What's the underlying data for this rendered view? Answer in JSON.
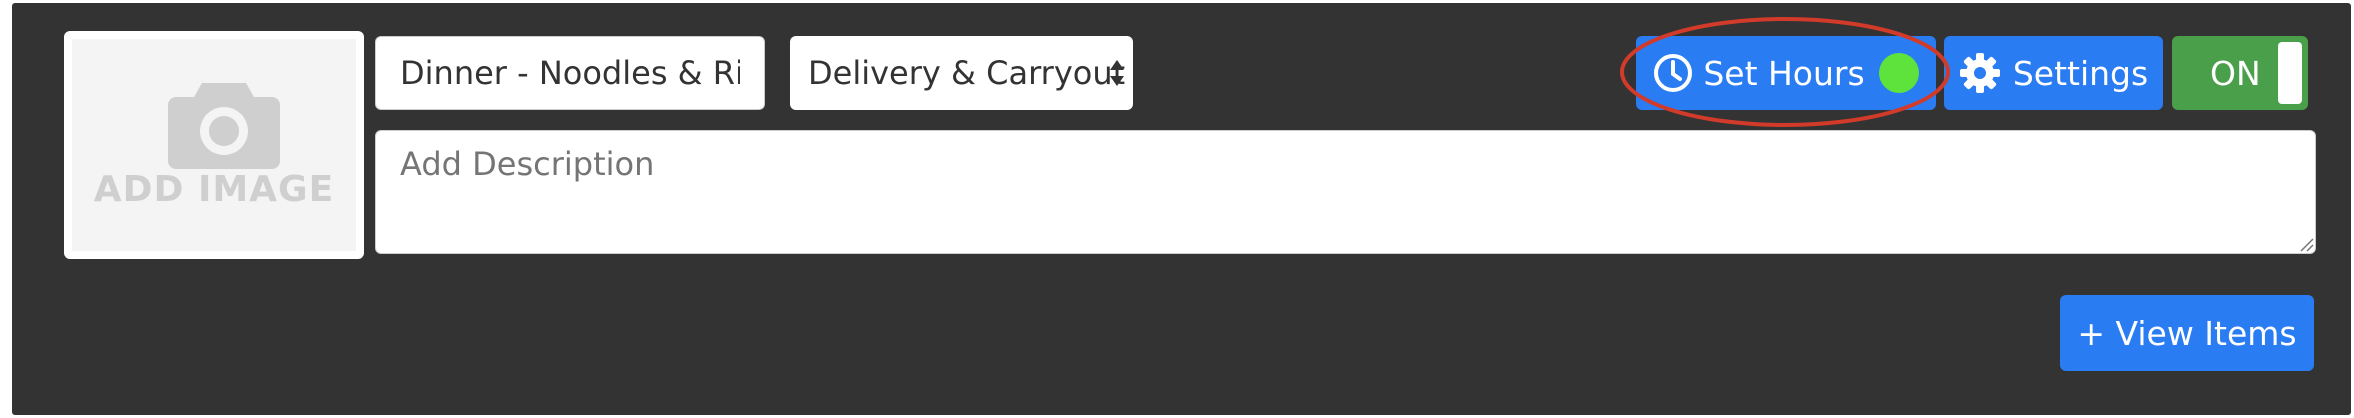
{
  "image_upload": {
    "label": "ADD IMAGE",
    "icon": "camera-icon"
  },
  "menu_name": {
    "value": "Dinner - Noodles & Rice"
  },
  "service_type": {
    "selected": "Delivery & Carryout"
  },
  "set_hours": {
    "label": "Set Hours",
    "icon": "clock-icon",
    "status_color": "#5de33c"
  },
  "settings": {
    "label": "Settings",
    "icon": "gear-icon"
  },
  "toggle": {
    "label": "ON",
    "color": "#4aa04a"
  },
  "description": {
    "placeholder": "Add Description"
  },
  "view_items": {
    "label": "+ View Items"
  },
  "colors": {
    "panel": "#333333",
    "primary": "#2a7cf3",
    "annotation": "#d23a2a"
  }
}
